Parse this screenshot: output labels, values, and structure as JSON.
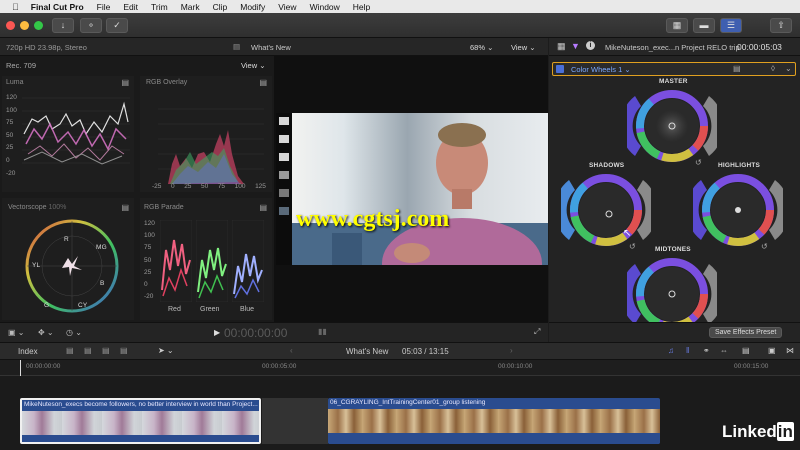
{
  "menubar": {
    "app_name": "Final Cut Pro",
    "items": [
      "File",
      "Edit",
      "Trim",
      "Mark",
      "Clip",
      "Modify",
      "View",
      "Window",
      "Help"
    ]
  },
  "viewer_info": {
    "format": "720p HD 23.98p, Stereo",
    "title": "What's New",
    "zoom": "68%",
    "view_menu": "View"
  },
  "scopes": {
    "color_space": "Rec. 709",
    "view_menu": "View",
    "luma": {
      "label": "Luma",
      "ticks": [
        "120",
        "100",
        "75",
        "50",
        "25",
        "0",
        "-20"
      ]
    },
    "rgb_overlay": {
      "label": "RGB Overlay",
      "xticks": [
        "-25",
        "0",
        "25",
        "50",
        "75",
        "100",
        "125"
      ]
    },
    "vectorscope": {
      "label": "Vectorscope",
      "zoom": "100%",
      "targets": [
        "R",
        "MG",
        "YL",
        "B",
        "G",
        "CY"
      ]
    },
    "rgb_parade": {
      "label": "RGB Parade",
      "ticks": [
        "120",
        "100",
        "75",
        "50",
        "25",
        "0",
        "-20"
      ],
      "channels": [
        "Red",
        "Green",
        "Blue"
      ]
    }
  },
  "watermark": "www.cgtsj.com",
  "inspector": {
    "clip_name": "MikeNuteson_exec...n Project RELO trip",
    "duration": "00:00:05:03",
    "effect_name": "Color Wheels 1",
    "wheels": {
      "master": "MASTER",
      "shadows": "SHADOWS",
      "highlights": "HIGHLIGHTS",
      "midtones": "MIDTONES"
    },
    "save_preset": "Save Effects Preset"
  },
  "playback": {
    "timecode": "00:00:00:00"
  },
  "timeline": {
    "index_label": "Index",
    "project_name": "What's New",
    "position": "05:03 / 13:15",
    "ruler": [
      "00:00:00:00",
      "00:00:05:00",
      "00:00:10:00",
      "00:00:15:00"
    ],
    "clips": [
      {
        "name": "MikeNuteson_execs become followers, no better interview in world than Project..."
      },
      {
        "name": "06_CGRAYLING_IntTrainingCenter01_group listening"
      }
    ]
  },
  "branding": {
    "logo": "LinkedIn"
  },
  "colors": {
    "accent": "#7b68ee",
    "selection": "#e0a020",
    "clip_blue": "#2a4c8f"
  }
}
